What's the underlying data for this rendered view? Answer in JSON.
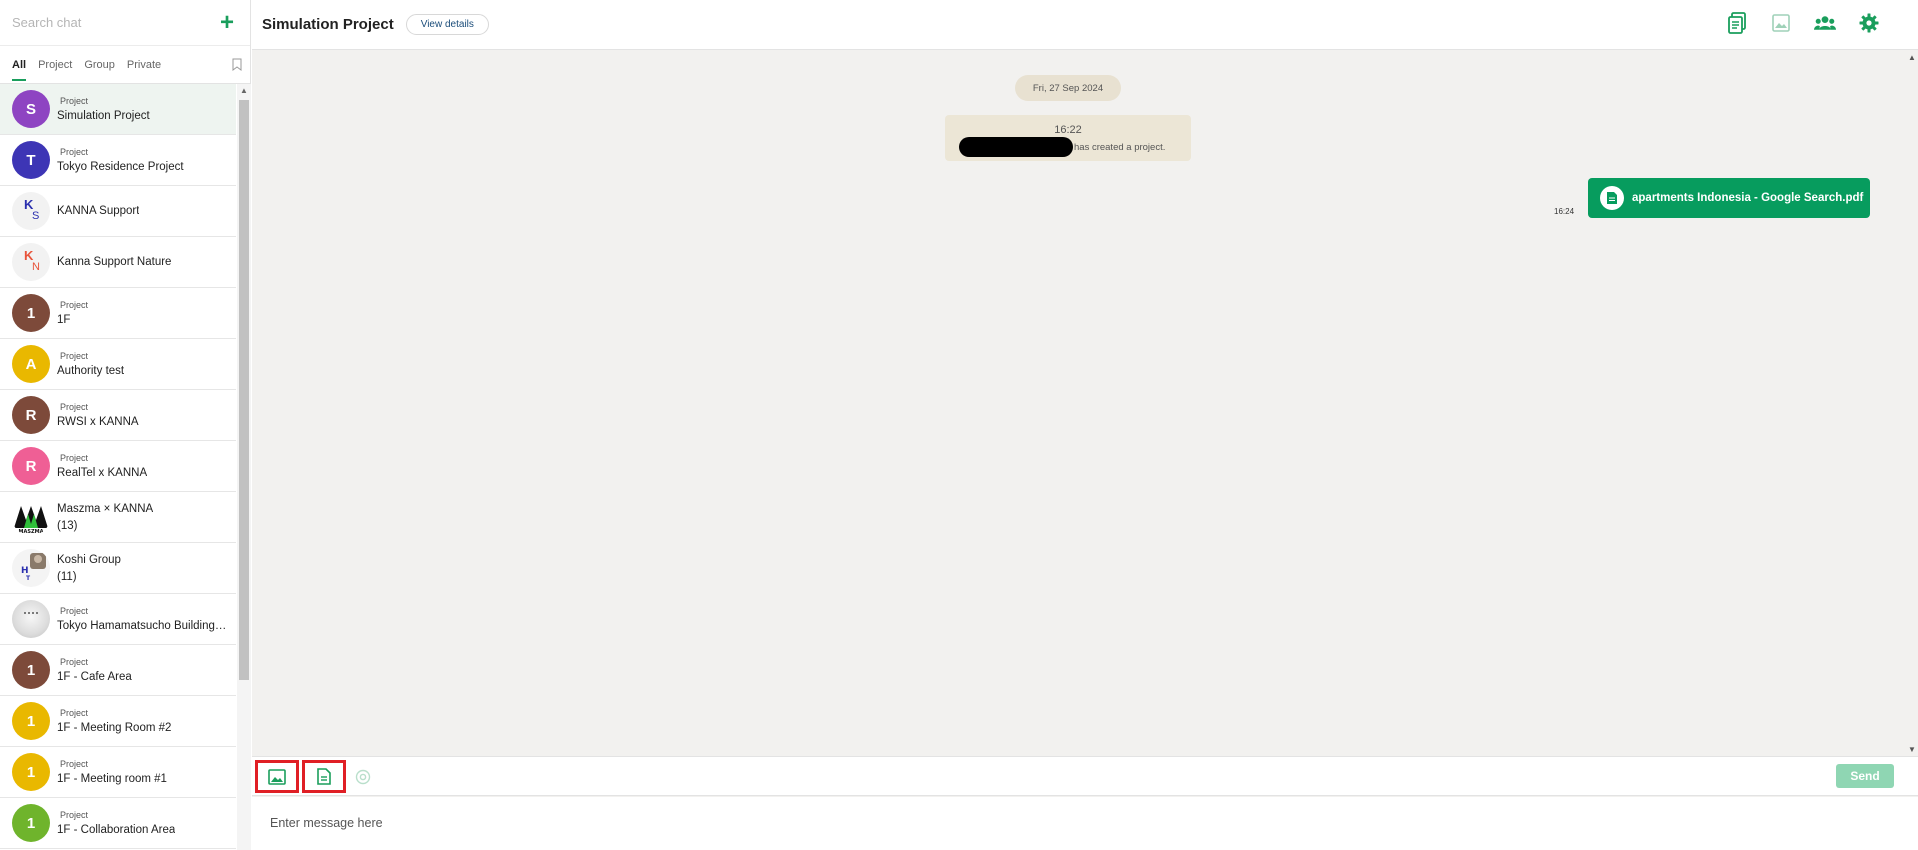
{
  "sidebar": {
    "search_placeholder": "Search chat",
    "filters": [
      {
        "label": "All",
        "active": true
      },
      {
        "label": "Project"
      },
      {
        "label": "Group"
      },
      {
        "label": "Private"
      }
    ],
    "chats": [
      {
        "tag": "Project",
        "name": "Simulation Project",
        "avatar": {
          "letter": "S",
          "color": "#8e44c2"
        },
        "selected": true
      },
      {
        "tag": "Project",
        "name": "Tokyo Residence Project",
        "avatar": {
          "letter": "T",
          "color": "#3d35b5"
        }
      },
      {
        "tag": "",
        "name": "KANNA Support",
        "avatar": {
          "letter": "K",
          "letter2": "S",
          "color": "#2a2fae"
        }
      },
      {
        "tag": "",
        "name": "Kanna Support Nature",
        "avatar": {
          "letter": "K",
          "letter2": "N",
          "color": "#e8533a"
        }
      },
      {
        "tag": "Project",
        "name": "1F",
        "avatar": {
          "letter": "1",
          "color": "#7d4a3a"
        }
      },
      {
        "tag": "Project",
        "name": "Authority test",
        "avatar": {
          "letter": "A",
          "color": "#e9b800"
        }
      },
      {
        "tag": "Project",
        "name": "RWSI x KANNA",
        "avatar": {
          "letter": "R",
          "color": "#7d4a3a"
        }
      },
      {
        "tag": "Project",
        "name": "RealTel x KANNA",
        "avatar": {
          "letter": "R",
          "color": "#ef5f95"
        }
      },
      {
        "tag": "",
        "name": "Maszma × KANNA",
        "count": "(13)",
        "avatar": {
          "image": "maszma-logo"
        }
      },
      {
        "tag": "",
        "name": "Koshi Group",
        "count": "(11)",
        "avatar": {
          "image": "koshi-group-photo"
        }
      },
      {
        "tag": "Project",
        "name": "Tokyo Hamamatsucho Building ...",
        "avatar": {
          "image": "building-photo"
        }
      },
      {
        "tag": "Project",
        "name": "1F - Cafe Area",
        "avatar": {
          "letter": "1",
          "color": "#7d4a3a"
        }
      },
      {
        "tag": "Project",
        "name": "1F - Meeting Room #2",
        "avatar": {
          "letter": "1",
          "color": "#e9b800"
        }
      },
      {
        "tag": "Project",
        "name": "1F - Meeting room #1",
        "avatar": {
          "letter": "1",
          "color": "#e9b800"
        }
      },
      {
        "tag": "Project",
        "name": "1F - Collaboration Area",
        "avatar": {
          "letter": "1",
          "color": "#6fb42c"
        }
      }
    ]
  },
  "header": {
    "title": "Simulation Project",
    "view_details": "View details",
    "icons": [
      "document-icon",
      "image-icon",
      "members-icon",
      "settings-icon"
    ]
  },
  "messages": {
    "date": "Fri, 27 Sep 2024",
    "system": {
      "time": "16:22",
      "text": "has created a project."
    },
    "file_message": {
      "time": "16:24",
      "file_name": "apartments Indonesia - Google Search.pdf"
    }
  },
  "composer": {
    "placeholder": "Enter message here",
    "send_label": "Send"
  },
  "colors": {
    "accent": "#079c5e",
    "highlight": "#e01f25",
    "send_disabled": "#8fd6b3"
  }
}
